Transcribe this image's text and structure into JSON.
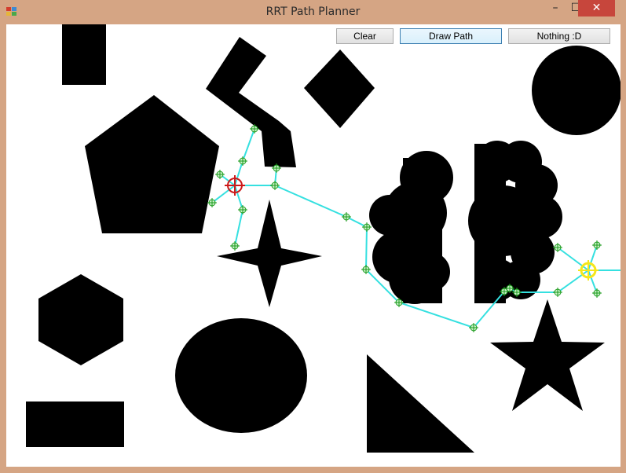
{
  "window": {
    "title": "RRT Path Planner",
    "min_glyph": "–",
    "max_glyph": "☐",
    "close_glyph": "✕"
  },
  "toolbar": {
    "clear_label": "Clear",
    "draw_path_label": "Draw Path",
    "nothing_label": "Nothing :D"
  },
  "colors": {
    "frame": "#d5a584",
    "obstacle": "#000000",
    "path": "#35e0e0",
    "node": "#1a9a1a",
    "start_marker": "#cc1a1a",
    "goal_marker": "#f5e61a",
    "close_button": "#c7463c"
  },
  "icons": {
    "app": "app-icon",
    "minimize": "minimize-icon",
    "maximize": "maximize-icon",
    "close": "close-icon",
    "start": "start-crosshair-icon",
    "goal": "goal-crosshair-icon",
    "node": "node-crosshair-icon"
  }
}
